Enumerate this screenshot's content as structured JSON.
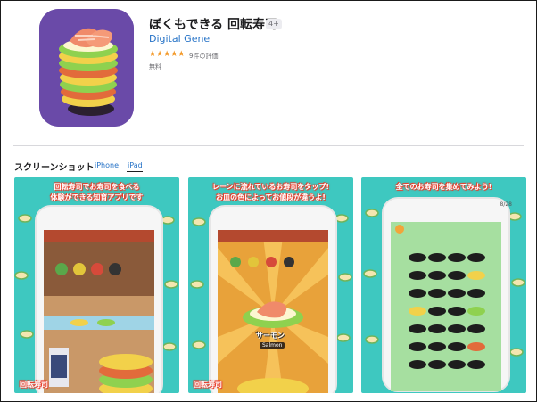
{
  "app": {
    "title": "ぼくもできる 回転寿司",
    "age_rating": "4+",
    "developer": "Digital Gene",
    "stars": "★★★★★",
    "rating_count": "9件の評価",
    "price": "無料"
  },
  "screenshots_section": {
    "title": "スクリーンショット",
    "tabs": [
      {
        "label": "iPhone",
        "selected": false
      },
      {
        "label": "iPad",
        "selected": true
      }
    ]
  },
  "screenshots": [
    {
      "line1": "回転寿司でお寿司を食べる",
      "line2": "体験ができる知育アプリです",
      "logo": "回転寿司"
    },
    {
      "line1": "レーンに流れているお寿司をタップ!",
      "line2": "お皿の色によってお値段が違うよ!",
      "logo": "回転寿司",
      "item_jp": "サーモン",
      "item_en": "Salmon"
    },
    {
      "line1": "全てのお寿司を集めてみよう!",
      "line2": "",
      "counter": "8/28"
    }
  ],
  "colors": {
    "accent": "#2673c7",
    "star": "#f39a2b",
    "screenshot_bg": "#3ec8c0",
    "caption_outline": "#e8402f"
  }
}
